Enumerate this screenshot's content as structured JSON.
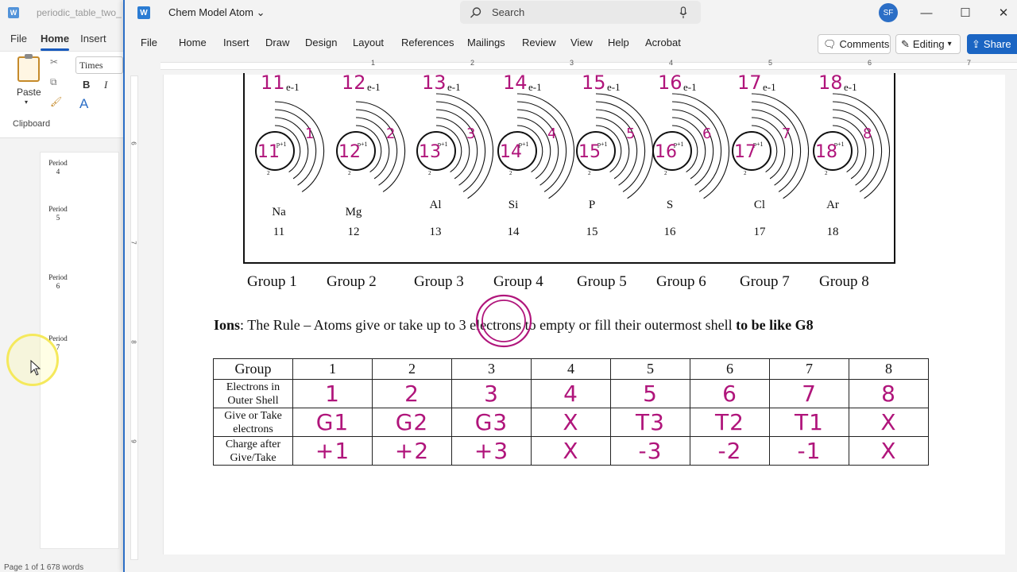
{
  "background_window": {
    "title": "periodic_table_two_",
    "menu": [
      "File",
      "Home",
      "Insert"
    ],
    "font_name": "Times",
    "paste_label": "Paste",
    "clipboard_label": "Clipboard",
    "bold_label": "B",
    "italic_label": "I",
    "font_color_label": "A",
    "periods": [
      {
        "label": "Period",
        "num": "4"
      },
      {
        "label": "Period",
        "num": "5"
      },
      {
        "label": "Period",
        "num": "6"
      },
      {
        "label": "Period",
        "num": "7"
      }
    ],
    "status": "Page 1 of 1    678 words"
  },
  "main_window": {
    "doc_title": "Chem Model Atom",
    "search_placeholder": "Search",
    "user_initials": "SF",
    "menu": [
      "File",
      "Home",
      "Insert",
      "Draw",
      "Design",
      "Layout",
      "References",
      "Mailings",
      "Review",
      "View",
      "Help",
      "Acrobat"
    ],
    "comments_label": "Comments",
    "editing_label": "Editing",
    "share_label": "Share",
    "ruler_numbers": [
      "1",
      "2",
      "3",
      "4",
      "5",
      "6",
      "7"
    ],
    "vruler_numbers": [
      "6",
      "7",
      "8",
      "9"
    ]
  },
  "document": {
    "elements": [
      {
        "symbol": "Na",
        "number": "11",
        "electrons": "11",
        "outer": "1"
      },
      {
        "symbol": "Mg",
        "number": "12",
        "electrons": "12",
        "outer": "2"
      },
      {
        "symbol": "Al",
        "number": "13",
        "electrons": "13",
        "outer": "3"
      },
      {
        "symbol": "Si",
        "number": "14",
        "electrons": "14",
        "outer": "4"
      },
      {
        "symbol": "P",
        "number": "15",
        "electrons": "15",
        "outer": "5"
      },
      {
        "symbol": "S",
        "number": "16",
        "electrons": "16",
        "outer": "6"
      },
      {
        "symbol": "Cl",
        "number": "17",
        "electrons": "17",
        "outer": "7"
      },
      {
        "symbol": "Ar",
        "number": "18",
        "electrons": "18",
        "outer": "8"
      }
    ],
    "electron_label": "e-1",
    "proton_label": "p+1",
    "groups": [
      "Group 1",
      "Group 2",
      "Group 3",
      "Group 4",
      "Group 5",
      "Group 6",
      "Group 7",
      "Group 8"
    ],
    "rule": {
      "lead": "Ions",
      "text": ":  The Rule – Atoms give or take up to 3 electrons to empty or fill their outermost shell ",
      "bold_tail": "to be like G8"
    },
    "table": {
      "header": [
        "Group",
        "1",
        "2",
        "3",
        "4",
        "5",
        "6",
        "7",
        "8"
      ],
      "rows": [
        {
          "label": "Electrons in Outer Shell",
          "values": [
            "1",
            "2",
            "3",
            "4",
            "5",
            "6",
            "7",
            "8"
          ]
        },
        {
          "label": "Give or Take electrons",
          "values": [
            "G1",
            "G2",
            "G3",
            "X",
            "T3",
            "T2",
            "T1",
            "X"
          ]
        },
        {
          "label": "Charge after Give/Take",
          "values": [
            "+1",
            "+2",
            "+3",
            "X",
            "-3",
            "-2",
            "-1",
            "X"
          ]
        }
      ]
    },
    "ink_color": "#b0157b"
  }
}
